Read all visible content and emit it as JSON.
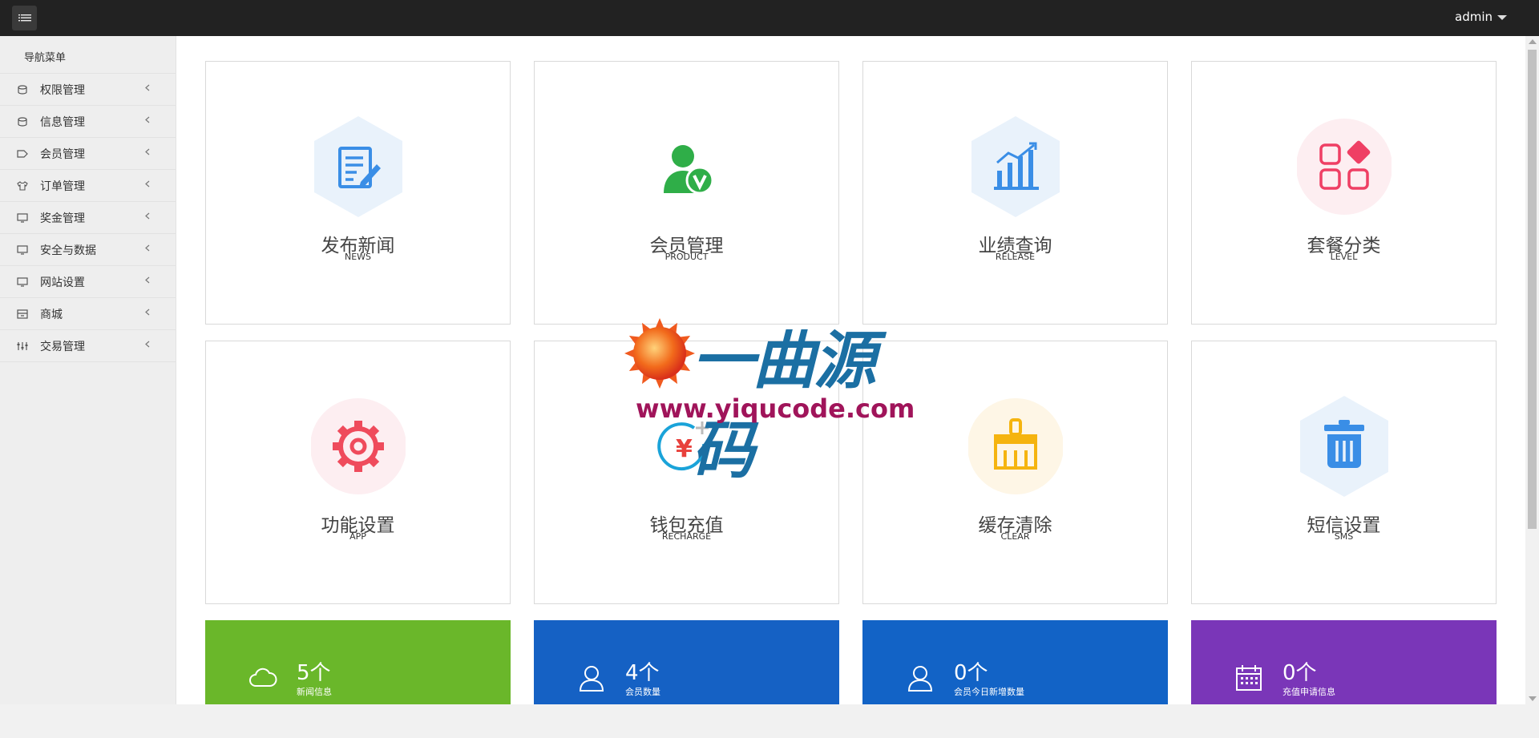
{
  "topbar": {
    "user": "admin"
  },
  "sidebar": {
    "title": "导航菜单",
    "items": [
      {
        "label": "权限管理",
        "icon": "server-icon"
      },
      {
        "label": "信息管理",
        "icon": "server-icon"
      },
      {
        "label": "会员管理",
        "icon": "tag-icon"
      },
      {
        "label": "订单管理",
        "icon": "shirt-icon"
      },
      {
        "label": "奖金管理",
        "icon": "monitor-icon"
      },
      {
        "label": "安全与数据",
        "icon": "monitor-icon"
      },
      {
        "label": "网站设置",
        "icon": "monitor-icon"
      },
      {
        "label": "商城",
        "icon": "archive-icon"
      },
      {
        "label": "交易管理",
        "icon": "sliders-icon"
      }
    ]
  },
  "cards": [
    {
      "title": "发布新闻",
      "sub": "NEWS",
      "icon": "news-edit-icon"
    },
    {
      "title": "会员管理",
      "sub": "PRODUCT",
      "icon": "member-verified-icon"
    },
    {
      "title": "业绩查询",
      "sub": "RELEASE",
      "icon": "bar-chart-icon"
    },
    {
      "title": "套餐分类",
      "sub": "LEVEL",
      "icon": "category-grid-icon"
    },
    {
      "title": "功能设置",
      "sub": "APP",
      "icon": "gear-icon"
    },
    {
      "title": "钱包充值",
      "sub": "RECHARGE",
      "icon": "recharge-icon"
    },
    {
      "title": "缓存清除",
      "sub": "CLEAR",
      "icon": "broom-icon"
    },
    {
      "title": "短信设置",
      "sub": "SMS",
      "icon": "trash-icon"
    }
  ],
  "stats": [
    {
      "value": "5个",
      "label": "新闻信息",
      "color": "#6ab72a",
      "icon": "cloud-icon"
    },
    {
      "value": "4个",
      "label": "会员数量",
      "color": "#1561c4",
      "icon": "user-icon"
    },
    {
      "value": "0个",
      "label": "会员今日新增数量",
      "color": "#1263c6",
      "icon": "user-icon"
    },
    {
      "value": "0个",
      "label": "充值申请信息",
      "color": "#7a36b8",
      "icon": "calendar-icon"
    }
  ],
  "watermark": {
    "text": "一曲源码",
    "url": "www.yiqucode.com"
  }
}
